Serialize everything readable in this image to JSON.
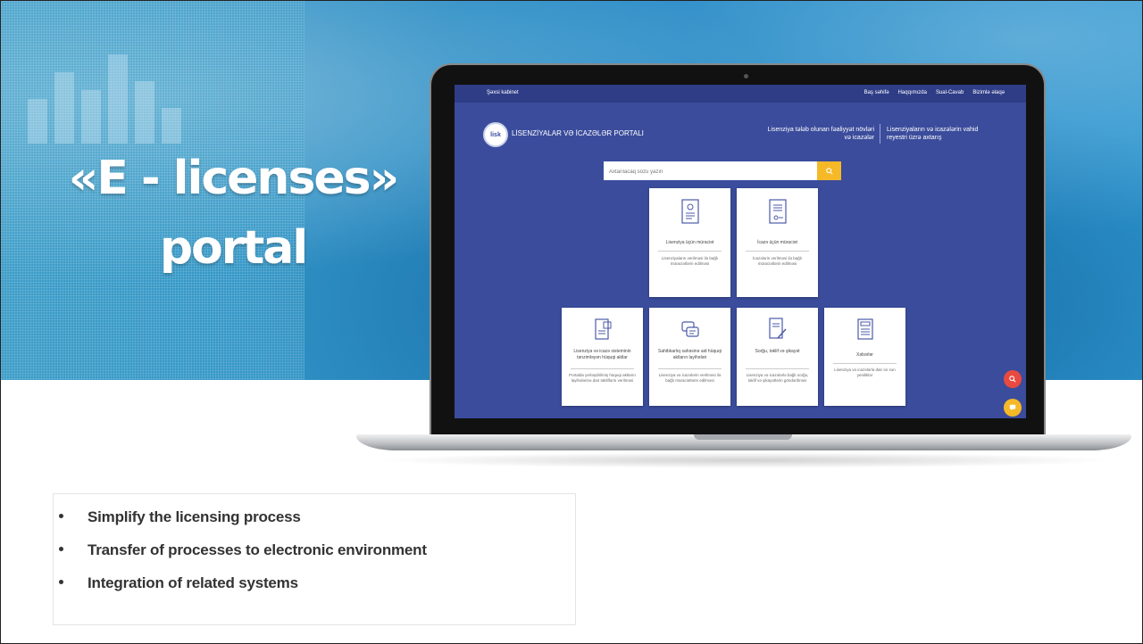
{
  "title": {
    "line1": "«E - licenses»",
    "line2": "portal"
  },
  "portal": {
    "cabinet": "Şəxsi kabinet",
    "nav": [
      "Baş səhifə",
      "Haqqımızda",
      "Sual-Cavab",
      "Bizimlə əlaqə"
    ],
    "logo_text": "lisk",
    "name": "LİSENZİYALAR VƏ İCAZƏLƏR PORTALI",
    "link1": "Lisenziya tələb olunan fəaliyyət növləri və icazələr",
    "link2": "Lisenziyaların və icazələrin vahid reyestri üzrə axtarış",
    "search_placeholder": "Axtarılacaq sözü yazın",
    "cards_top": [
      {
        "title": "Lisenziya üçün müraciət",
        "desc": "Lisenziyaların verilməsi ilə bağlı müraciətlərin edilməsi"
      },
      {
        "title": "İcazə üçün müraciət",
        "desc": "İcazələrin verilməsi ilə bağlı müraciətlərin edilməsi"
      }
    ],
    "cards_bottom": [
      {
        "title": "Lisenziya və icazə sisteminin tənzimləyən hüquqi aktlar",
        "desc": "Portalda yerləşdirilmiş hüquqi aktların layihələrinə dair təkliflərin verilməsi"
      },
      {
        "title": "Sahibkarlıq sahəsinə aid hüquqi aktların layihələri",
        "desc": "Lisenziya və icazələrin verilməsi ilə bağlı müraciətlərin edilməsi"
      },
      {
        "title": "Sorğu, təklif və şikayət",
        "desc": "Lisenziya və icazələrlə bağlı sorğu, təklif və şikayətlərin göndərilməsi"
      },
      {
        "title": "Xəbərlər",
        "desc": "Lisenziya və icazələrlə dair ən son yeniliklər"
      }
    ]
  },
  "bullets": [
    "Simplify the licensing process",
    "Transfer of processes to electronic environment",
    "Integration of related systems"
  ],
  "colors": {
    "portal_bg": "#3b4c9c",
    "accent": "#f5b928",
    "fab_red": "#e84a3f",
    "fab_yellow": "#f5b928"
  }
}
